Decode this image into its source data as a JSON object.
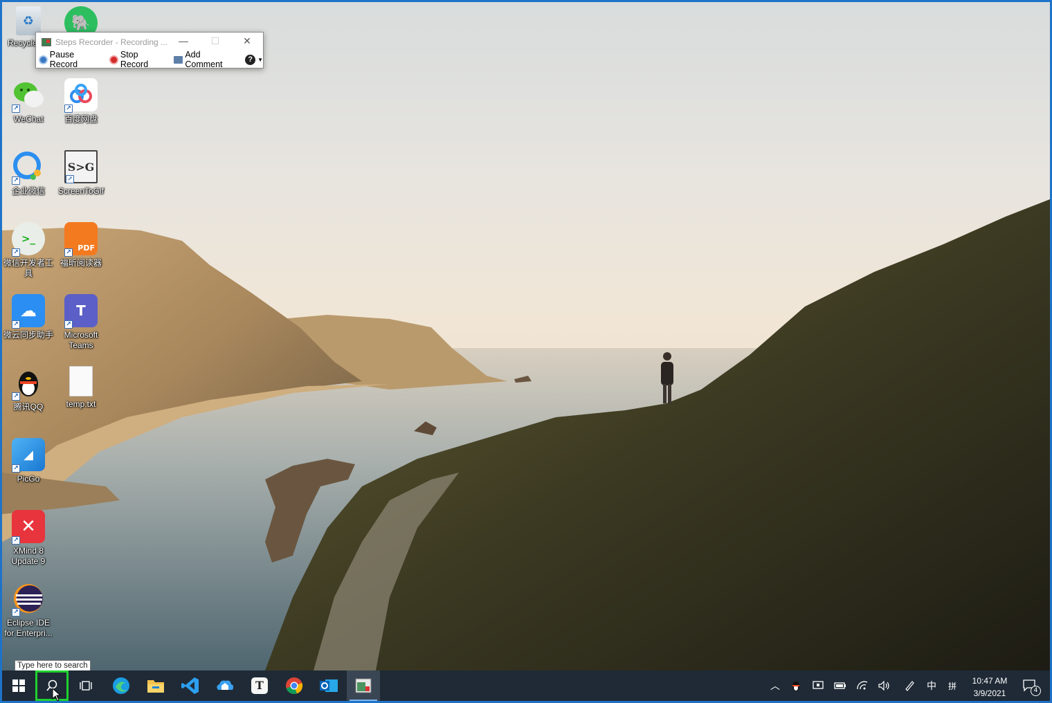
{
  "steps_recorder": {
    "title": "Steps Recorder - Recording ...",
    "pause_label": "Pause Record",
    "stop_label": "Stop Record",
    "comment_label": "Add Comment",
    "help_label": "?"
  },
  "desktop_icons": {
    "recycle": "Recycle",
    "evernote": "",
    "wechat": "WeChat",
    "baidu": "百度网盘",
    "wxwork": "企业微信",
    "screentogif": "ScreenToGif",
    "wxdev": "微信开发者工具",
    "foxit": "福昕阅读器",
    "weiyun": "微云同步助手",
    "teams": "Microsoft Teams",
    "qq": "腾讯QQ",
    "temp": "temp.txt",
    "picgo": "PicGo",
    "xmind": "XMind 8 Update 9",
    "eclipse": "Eclipse IDE for Enterpri..."
  },
  "icon_glyphs": {
    "screentogif": "S>G",
    "teams": "T",
    "foxit_pdf": "PDF",
    "typora": "T"
  },
  "taskbar": {
    "search_tooltip": "Type here to search",
    "ime_label": "中",
    "ime_mode": "拼",
    "time": "10:47 AM",
    "date": "3/9/2021",
    "notification_count": "4"
  },
  "colors": {
    "taskbar_bg": "#1f2a36",
    "highlight": "#1fd12f",
    "accent": "#1e73c8"
  }
}
